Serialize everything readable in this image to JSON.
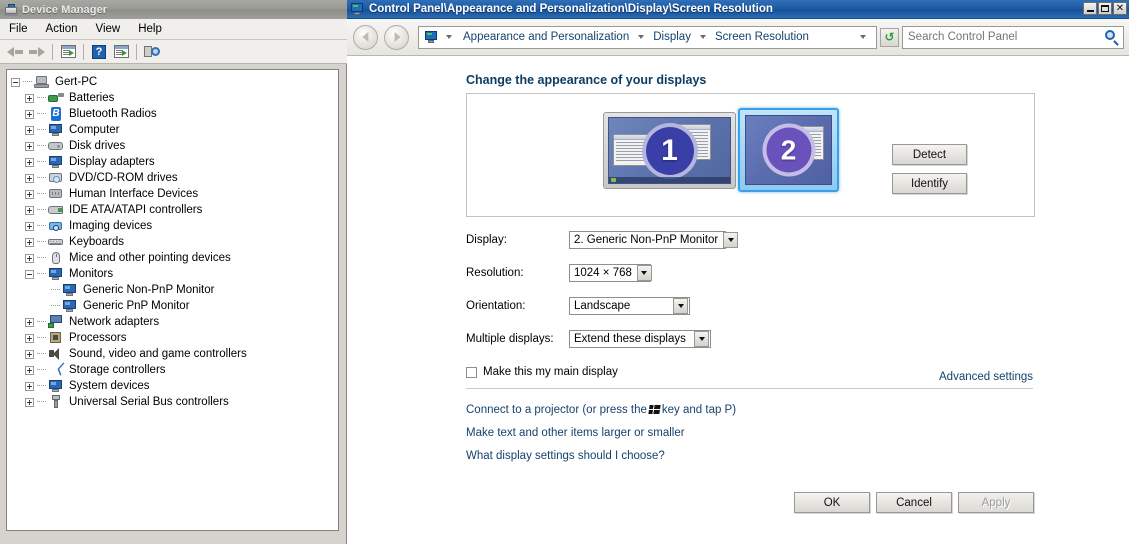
{
  "device_manager": {
    "title": "Device Manager",
    "icon": "device-manager-icon",
    "menu": [
      "File",
      "Action",
      "View",
      "Help"
    ],
    "toolbar": [
      {
        "name": "back-arrow-icon",
        "label": "Back"
      },
      {
        "name": "forward-arrow-icon",
        "label": "Forward"
      },
      {
        "name": "properties-icon",
        "label": "Properties"
      },
      {
        "name": "help-icon",
        "label": "Help"
      },
      {
        "name": "update-driver-icon",
        "label": "Update Driver Software"
      },
      {
        "name": "scan-hardware-icon",
        "label": "Scan for hardware changes"
      }
    ],
    "tree": [
      {
        "label": "Gert-PC",
        "level": 0,
        "state": "expanded",
        "icon": "computer-icon"
      },
      {
        "label": "Batteries",
        "level": 1,
        "state": "collapsed",
        "icon": "battery-icon"
      },
      {
        "label": "Bluetooth Radios",
        "level": 1,
        "state": "collapsed",
        "icon": "bluetooth-icon"
      },
      {
        "label": "Computer",
        "level": 1,
        "state": "collapsed",
        "icon": "computer-node-icon"
      },
      {
        "label": "Disk drives",
        "level": 1,
        "state": "collapsed",
        "icon": "disk-drive-icon"
      },
      {
        "label": "Display adapters",
        "level": 1,
        "state": "collapsed",
        "icon": "display-adapter-icon"
      },
      {
        "label": "DVD/CD-ROM drives",
        "level": 1,
        "state": "collapsed",
        "icon": "dvd-drive-icon"
      },
      {
        "label": "Human Interface Devices",
        "level": 1,
        "state": "collapsed",
        "icon": "hid-icon"
      },
      {
        "label": "IDE ATA/ATAPI controllers",
        "level": 1,
        "state": "collapsed",
        "icon": "ide-controller-icon"
      },
      {
        "label": "Imaging devices",
        "level": 1,
        "state": "collapsed",
        "icon": "imaging-device-icon"
      },
      {
        "label": "Keyboards",
        "level": 1,
        "state": "collapsed",
        "icon": "keyboard-icon"
      },
      {
        "label": "Mice and other pointing devices",
        "level": 1,
        "state": "collapsed",
        "icon": "mouse-icon"
      },
      {
        "label": "Monitors",
        "level": 1,
        "state": "expanded",
        "icon": "monitor-icon"
      },
      {
        "label": "Generic Non-PnP Monitor",
        "level": 2,
        "state": "leaf",
        "icon": "monitor-icon"
      },
      {
        "label": "Generic PnP Monitor",
        "level": 2,
        "state": "leaf",
        "icon": "monitor-icon"
      },
      {
        "label": "Network adapters",
        "level": 1,
        "state": "collapsed",
        "icon": "network-adapter-icon"
      },
      {
        "label": "Processors",
        "level": 1,
        "state": "collapsed",
        "icon": "processor-icon"
      },
      {
        "label": "Sound, video and game controllers",
        "level": 1,
        "state": "collapsed",
        "icon": "sound-icon"
      },
      {
        "label": "Storage controllers",
        "level": 1,
        "state": "collapsed",
        "icon": "storage-controller-icon"
      },
      {
        "label": "System devices",
        "level": 1,
        "state": "collapsed",
        "icon": "system-device-icon"
      },
      {
        "label": "Universal Serial Bus controllers",
        "level": 1,
        "state": "collapsed",
        "icon": "usb-icon"
      }
    ]
  },
  "control_panel": {
    "title": "Control Panel\\Appearance and Personalization\\Display\\Screen Resolution",
    "window_buttons": {
      "minimize": "_",
      "maximize": "□",
      "close": "✕"
    },
    "breadcrumbs": [
      "Appearance and Personalization",
      "Display",
      "Screen Resolution"
    ],
    "refresh_label": "Refresh",
    "search": {
      "placeholder": "Search Control Panel",
      "value": ""
    },
    "heading": "Change the appearance of your displays",
    "preview": {
      "monitor1": {
        "number": "1",
        "selected": false
      },
      "monitor2": {
        "number": "2",
        "selected": true
      }
    },
    "buttons": {
      "detect": "Detect",
      "identify": "Identify"
    },
    "fields": [
      {
        "label": "Display:",
        "value": "2. Generic Non-PnP Monitor"
      },
      {
        "label": "Resolution:",
        "value": "1024 × 768"
      },
      {
        "label": "Orientation:",
        "value": "Landscape"
      },
      {
        "label": "Multiple displays:",
        "value": "Extend these displays"
      }
    ],
    "checkbox": {
      "label": "Make this my main display",
      "checked": false
    },
    "advanced_settings": "Advanced settings",
    "links": {
      "projector_pre": "Connect to a projector (or press the",
      "projector_post": "key and tap P)",
      "text_size": "Make text and other items larger or smaller",
      "help": "What display settings should I choose?"
    },
    "dialog_buttons": {
      "ok": "OK",
      "cancel": "Cancel",
      "apply": "Apply",
      "apply_disabled": true
    }
  },
  "colors": {
    "cp_titlebar": "#1f5ba4",
    "dm_titlebar": "#999994",
    "link": "#15426e",
    "heading": "#0b3d66",
    "selected_monitor_border": "#3ca0e8"
  }
}
